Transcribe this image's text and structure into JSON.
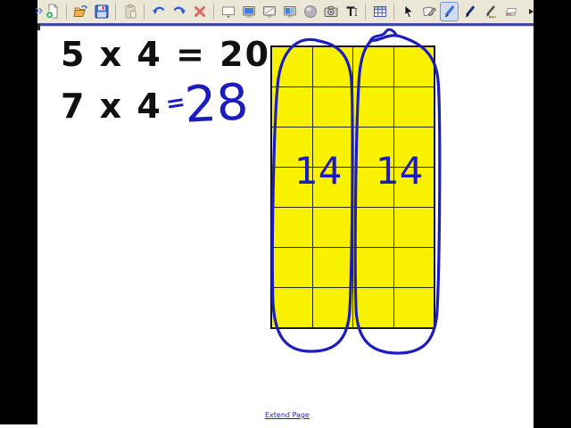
{
  "toolbar": {
    "selected_tool": "pen",
    "icons": [
      "new-page",
      "open-file",
      "save",
      "paste",
      "undo",
      "redo",
      "delete",
      "whiteboard-view",
      "fullscreen-view",
      "transparent-background-view",
      "dual-page-view",
      "ball",
      "screen-capture",
      "text-tool",
      "insert-table",
      "select",
      "shapes",
      "pen",
      "line-pen",
      "creative-pen",
      "eraser",
      "more-tools"
    ]
  },
  "board": {
    "equations": {
      "line1": "5 x 4 = 20",
      "line2": "7 x 4"
    },
    "ink": {
      "color": "#1c1cc0",
      "equals": "=",
      "answer": "28",
      "group_labels": [
        "14",
        "14"
      ]
    },
    "grid": {
      "columns": 4,
      "rows": 7,
      "cell_color": "#f8f200",
      "line_color": "#2a2a20"
    },
    "footer": {
      "extend_page": "Extend Page"
    }
  },
  "colors": {
    "toolbar_bg": "#ebe7d6",
    "toolbar_underline": "#3d4a9e",
    "canvas_bg": "#ffffff",
    "letterbox": "#000000",
    "equation_text": "#111111",
    "link_blue": "#2222cc"
  }
}
